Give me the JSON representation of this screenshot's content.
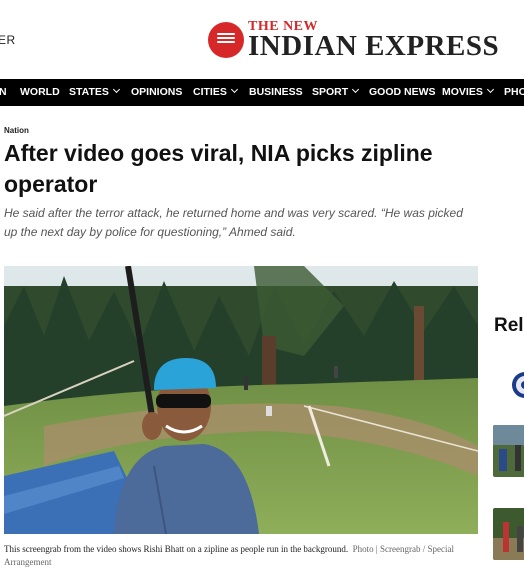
{
  "masthead": {
    "left_cut_text": "ER",
    "logo_top": "THE NEW",
    "logo_main": "INDIAN EXPRESS"
  },
  "nav": {
    "items": [
      {
        "label": "N",
        "chevron": false
      },
      {
        "label": "WORLD",
        "chevron": false
      },
      {
        "label": "STATES",
        "chevron": true
      },
      {
        "label": "OPINIONS",
        "chevron": false
      },
      {
        "label": "CITIES",
        "chevron": true
      },
      {
        "label": "BUSINESS",
        "chevron": false
      },
      {
        "label": "SPORT",
        "chevron": true
      },
      {
        "label": "GOOD NEWS",
        "chevron": false
      },
      {
        "label": "MOVIES",
        "chevron": true
      },
      {
        "label": "PHO",
        "chevron": false
      }
    ]
  },
  "article": {
    "section": "Nation",
    "headline": "After video goes viral, NIA picks zipline operator",
    "dek": "He said after the terror attack, he returned home and was very scared. “He was picked up the next day by police for questioning,” Ahmed said.",
    "caption": "This screengrab from the video shows Rishi Bhatt on a zipline as people run in the background.",
    "credit": "Photo | Screengrab / Special Arrangement"
  },
  "related": {
    "title": "Rela"
  },
  "colors": {
    "brand_red": "#d62828",
    "nav_bg": "#000000"
  }
}
